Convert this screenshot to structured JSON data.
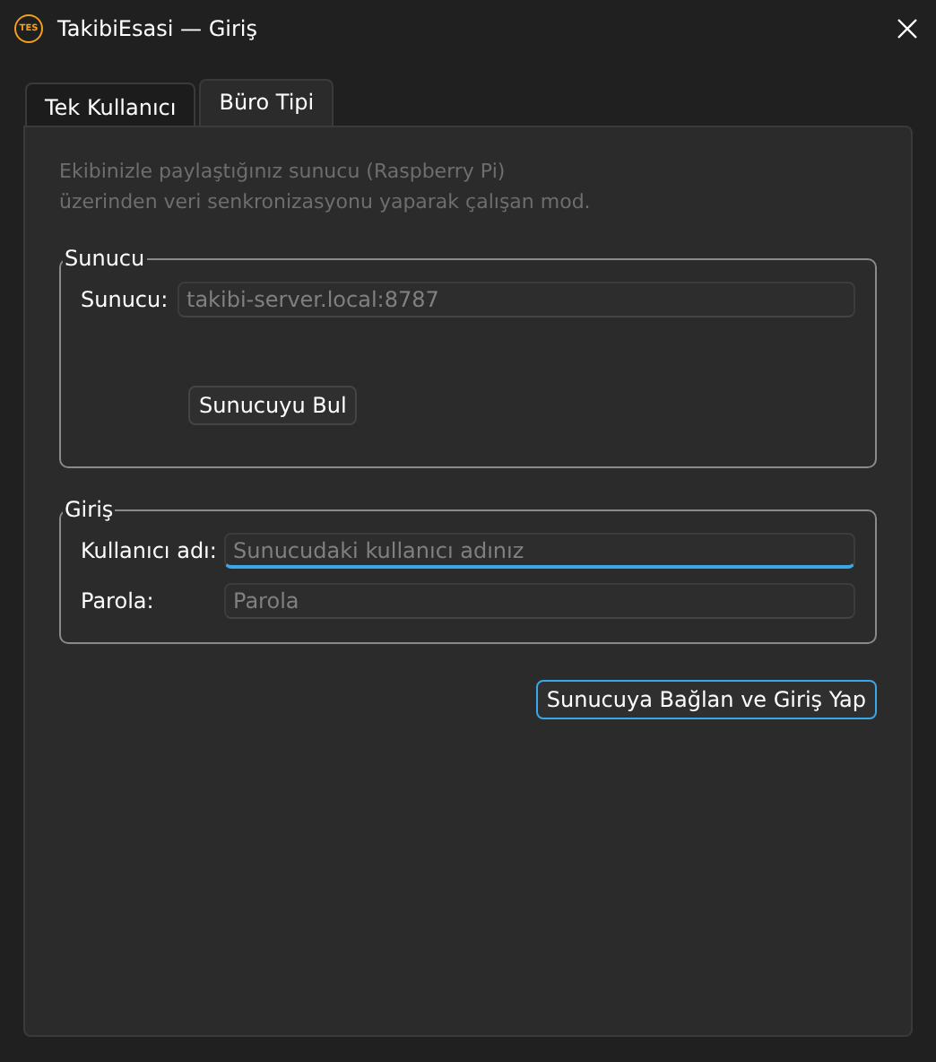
{
  "window": {
    "title": "TakibiEsasi — Giriş",
    "logo": "TES"
  },
  "tabs": [
    {
      "label": "Tek Kullanıcı",
      "selected": false
    },
    {
      "label": "Büro Tipi",
      "selected": true
    }
  ],
  "description": "Ekibinizle paylaştığınız sunucu (Raspberry Pi) üzerinden veri senkronizasyonu yaparak çalışan mod.",
  "server_group": {
    "title": "Sunucu",
    "fields": [
      {
        "label": "Sunucu:",
        "placeholder": "takibi-server.local:8787",
        "focused": false
      }
    ],
    "button": "Sunucuyu Bul"
  },
  "login_group": {
    "title": "Giriş",
    "fields": [
      {
        "label": "Kullanıcı adı:",
        "placeholder": "Sunucudaki kullanıcı adınız",
        "focused": true
      },
      {
        "label": "Parola:",
        "placeholder": "Parola",
        "focused": false
      }
    ]
  },
  "submit_button": "Sunucuya Bağlan ve Giriş Yap"
}
